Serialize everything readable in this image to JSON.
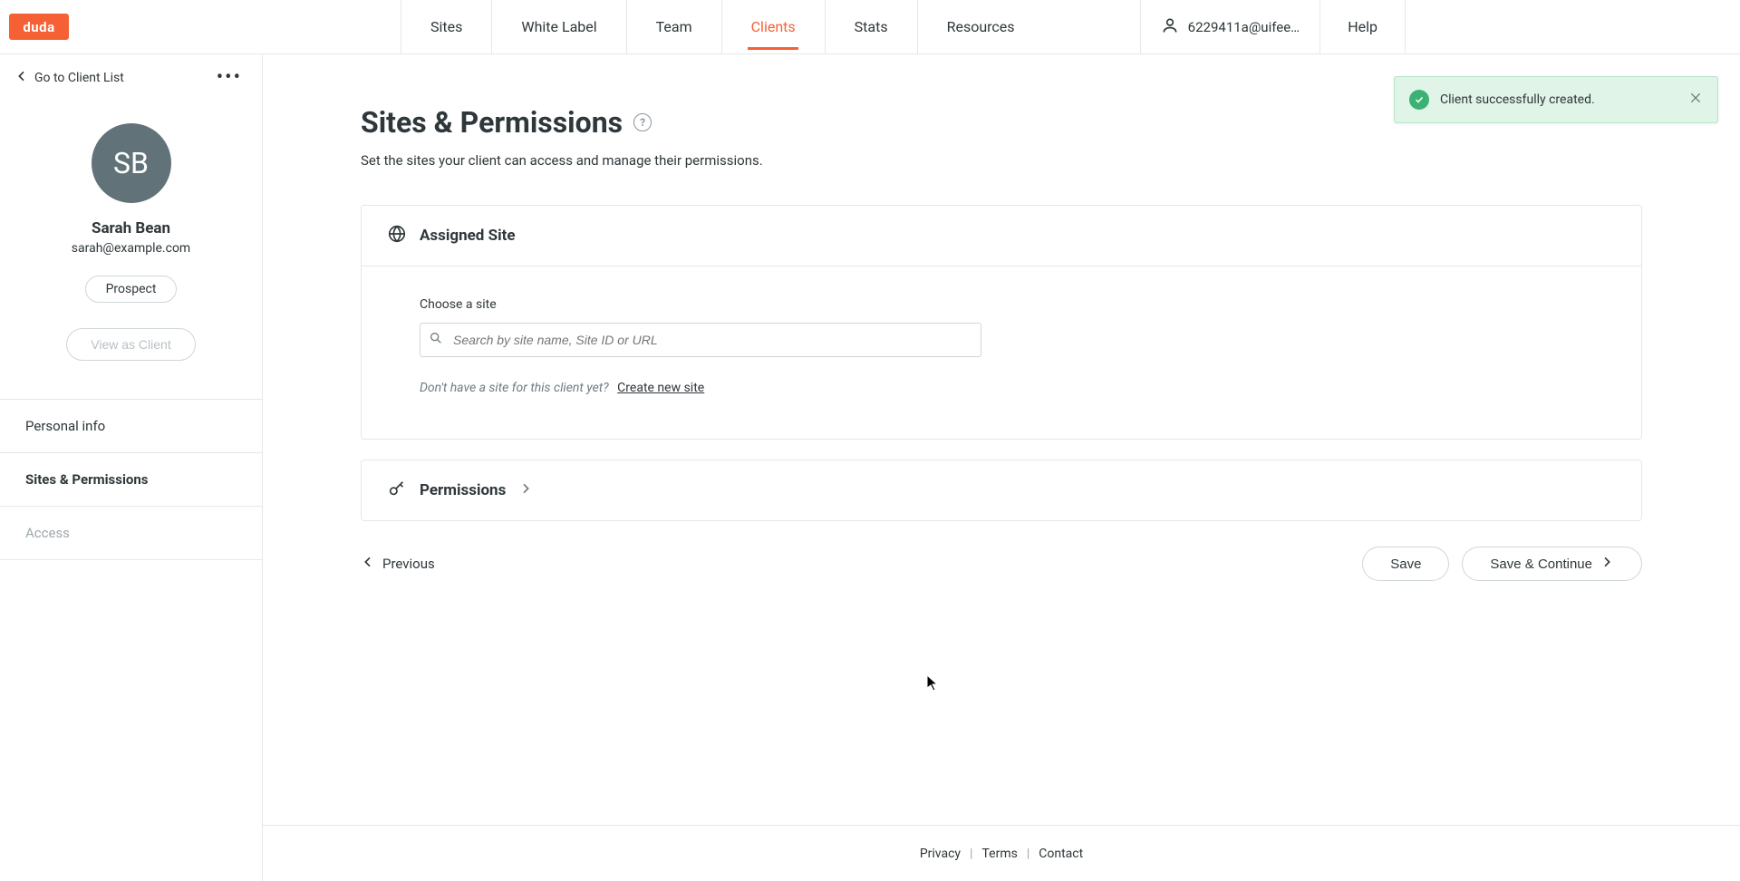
{
  "brand": {
    "logo_text": "duda"
  },
  "nav": {
    "items": [
      {
        "label": "Sites",
        "active": false
      },
      {
        "label": "White Label",
        "active": false
      },
      {
        "label": "Team",
        "active": false
      },
      {
        "label": "Clients",
        "active": true
      },
      {
        "label": "Stats",
        "active": false
      },
      {
        "label": "Resources",
        "active": false
      }
    ],
    "account_label": "6229411a@uifee…",
    "help_label": "Help"
  },
  "toast": {
    "text": "Client successfully created.",
    "type": "success"
  },
  "sidebar": {
    "back_label": "Go to Client List",
    "client": {
      "initials": "SB",
      "name": "Sarah Bean",
      "email": "sarah@example.com",
      "status_chip": "Prospect",
      "view_as_label": "View as Client"
    },
    "items": [
      {
        "label": "Personal info",
        "active": false,
        "muted": false
      },
      {
        "label": "Sites & Permissions",
        "active": true,
        "muted": false
      },
      {
        "label": "Access",
        "active": false,
        "muted": true
      }
    ]
  },
  "main": {
    "title": "Sites & Permissions",
    "subtitle": "Set the sites your client can access and manage their permissions.",
    "assigned_site": {
      "header": "Assigned Site",
      "field_label": "Choose a site",
      "search_placeholder": "Search by site name, Site ID or URL",
      "hint_text": "Don't have a site for this client yet?",
      "create_link": "Create new site"
    },
    "permissions": {
      "header": "Permissions"
    },
    "actions": {
      "previous": "Previous",
      "save": "Save",
      "save_continue": "Save & Continue"
    }
  },
  "footer": {
    "privacy": "Privacy",
    "terms": "Terms",
    "contact": "Contact"
  },
  "colors": {
    "accent": "#f66035",
    "success_bg": "#e1f4e8",
    "success_icon": "#3bb273"
  }
}
